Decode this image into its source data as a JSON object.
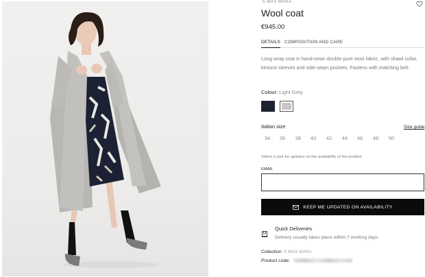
{
  "product": {
    "brand": "'S MAX MARA",
    "title": "Wool coat",
    "price": "€945.00"
  },
  "tabs": [
    {
      "label": "DETAILS",
      "active": true
    },
    {
      "label": "COMPOSITION AND CARE",
      "active": false
    }
  ],
  "description": "Long wrap coat in hand-sewn double pure wool fabric, with shawl collar, kimono sleeves and side-seam pockets. Fastens with matching belt.",
  "colour": {
    "label": "Colour:",
    "value": "Light Grey",
    "swatches": [
      {
        "name": "navy",
        "hex": "#1d2230",
        "selected": false
      },
      {
        "name": "light-grey",
        "hex": "#c9c7c3",
        "selected": true
      }
    ]
  },
  "size": {
    "label": "Italian size",
    "guide_label": "Size guide",
    "options": [
      "34",
      "36",
      "38",
      "40",
      "42",
      "44",
      "46",
      "48",
      "50"
    ]
  },
  "availability": {
    "note": "Select a size for updates on the availability of the product",
    "email_label": "EMAIL",
    "email_value": "",
    "button_label": "KEEP ME UPDATED ON AVAILABILITY",
    "button_icon": "envelope-icon"
  },
  "delivery": {
    "icon": "delivery-box-icon",
    "title": "Quick Deliveries",
    "text": "Delivery usually takes place within 7 working days"
  },
  "meta": {
    "collection_label": "Collection",
    "collection_value": "'S MAX MARA",
    "product_code_label": "Product code:"
  },
  "icons": {
    "wishlist": "heart-icon"
  },
  "colors": {
    "button_bg": "#0b0b0b",
    "text_muted": "#777777"
  }
}
